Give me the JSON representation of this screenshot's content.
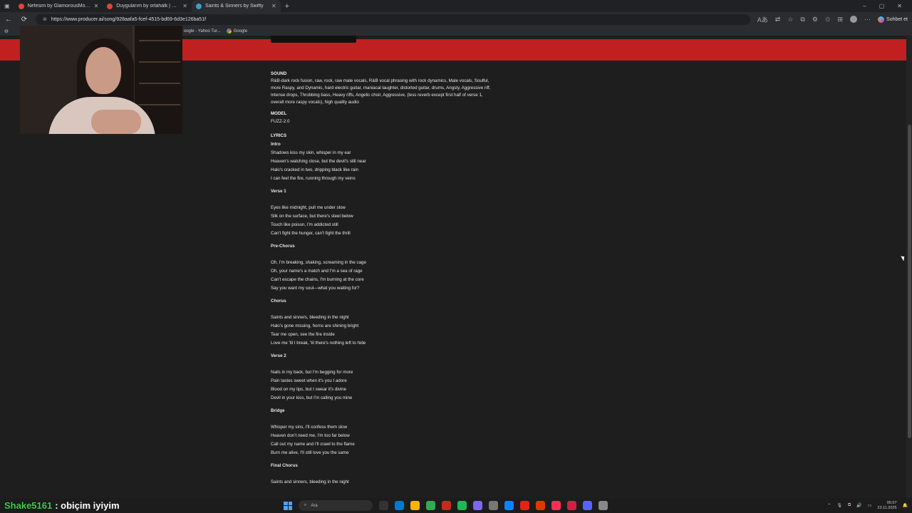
{
  "browser": {
    "tabs": [
      {
        "label": "Nefesim by GlamorousModulatio",
        "color": "#e0443a"
      },
      {
        "label": "Duygularım by ortahalk | Suno",
        "color": "#e0443a"
      },
      {
        "label": "Saints & Sinners by Swifty",
        "color": "#3aa0c8",
        "active": true
      }
    ],
    "new_tab": "+",
    "window_controls": [
      "–",
      "▢",
      "✕"
    ],
    "url": "https://www.producer.ai/song/928aafa5-fcef-4515-bd69-6d3e126ba51f",
    "chat_label": "Sohbet et",
    "bookmarks": [
      {
        "label": "oogle - Yahoo Tur..."
      },
      {
        "label": "Google"
      }
    ]
  },
  "song": {
    "sound_label": "SOUND",
    "sound_text": "R&B-dark rock fusion, raw, rock, raw male vocals, R&B vocal phrasing with rock dynamics, Male vocals, Soulful, more Raspy, and Dynamic, hard electric guitar, maniacal laughter, distorted guitar, drums, Angsty, Aggressive riff, Intense drops, Throbbing bass, Heavy riffs, Angelic choir, Aggressive, (less reverb except first half of verse 1, overall more raspy vocals), high quality audio",
    "model_label": "MODEL",
    "model_value": "FUZZ-2.0",
    "lyrics_label": "LYRICS",
    "stanzas": [
      {
        "head": "Intro",
        "lines": [
          "Shadows kiss my skin, whisper in my ear",
          "Heaven's watching close, but the devil's still near",
          "Halo's cracked in two, dripping black like rain",
          "I can feel the fire, running through my veins"
        ]
      },
      {
        "head": "Verse 1",
        "lines": [
          "Eyes like midnight, pull me under slow",
          "Silk on the surface, but there's steel below",
          "Touch like poison, I'm addicted still",
          "Can't fight the hunger, can't fight the thrill"
        ]
      },
      {
        "head": "Pre-Chorus",
        "lines": [
          "Oh, I'm breaking, shaking, screaming in the cage",
          "Oh, your name's a match and I'm a sea of rage",
          "Can't escape the chains, I'm burning at the core",
          "Say you want my soul—what you waiting for?"
        ]
      },
      {
        "head": "Chorus",
        "lines": [
          "Saints and sinners, bleeding in the night",
          "Halo's gone missing, horns are shining bright",
          "Tear me open, see the fire inside",
          "Love me 'til I break, 'til there's nothing left to hide"
        ]
      },
      {
        "head": "Verse 2",
        "lines": [
          "Nails in my back, but I'm begging for more",
          "Pain tastes sweet when it's you I adore",
          "Blood on my lips, but I swear it's divine",
          "Devil in your kiss, but I'm calling you mine"
        ]
      },
      {
        "head": "Bridge",
        "lines": [
          "Whisper my sins, I'll confess them slow",
          "Heaven don't need me, I'm too far below",
          "Call out my name and I'll crawl to the flame",
          "Burn me alive, I'll still love you the same"
        ]
      },
      {
        "head": "Final Chorus",
        "lines": [
          "Saints and sinners, bleeding in the night"
        ]
      }
    ]
  },
  "overlay": {
    "username": "Shake5161",
    "message": ": obiçim iyiyim"
  },
  "taskbar": {
    "search_placeholder": "Ara",
    "time": "05:07",
    "date": "23.11.2025",
    "icon_colors": [
      "#333",
      "#0078d4",
      "#f2b600",
      "#34a853",
      "#c42b1c",
      "#1db954",
      "#7b68ee",
      "#777",
      "#0a84ff",
      "#e62117",
      "#d83b01",
      "#ff2d55",
      "#cc2244",
      "#5865f2",
      "#888"
    ]
  }
}
